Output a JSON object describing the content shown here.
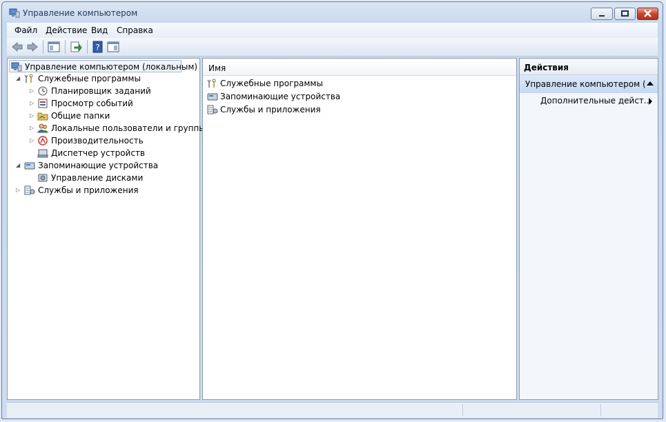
{
  "window": {
    "title": "Управление компьютером"
  },
  "menu": [
    "Файл",
    "Действие",
    "Вид",
    "Справка"
  ],
  "tree": {
    "root": "Управление компьютером (локальным)",
    "items": [
      {
        "label": "Служебные программы",
        "level": 1,
        "expanded": true
      },
      {
        "label": "Планировщик заданий",
        "level": 2,
        "expander": true
      },
      {
        "label": "Просмотр событий",
        "level": 2,
        "expander": true
      },
      {
        "label": "Общие папки",
        "level": 2,
        "expander": true
      },
      {
        "label": "Локальные пользователи и группы",
        "level": 2,
        "expander": true
      },
      {
        "label": "Производительность",
        "level": 2,
        "expander": true
      },
      {
        "label": "Диспетчер устройств",
        "level": 2,
        "expander": false
      },
      {
        "label": "Запоминающие устройства",
        "level": 1,
        "expanded": true
      },
      {
        "label": "Управление дисками",
        "level": 2,
        "expander": false
      },
      {
        "label": "Службы и приложения",
        "level": 1,
        "expanded": false
      }
    ]
  },
  "list": {
    "column": "Имя",
    "items": [
      "Служебные программы",
      "Запоминающие устройства",
      "Службы и приложения"
    ]
  },
  "actions": {
    "header": "Действия",
    "selected": "Управление компьютером (ло...",
    "more": "Дополнительные дейст..."
  },
  "icons": {
    "title": "computer-management-icon",
    "back": "back-arrow-icon",
    "forward": "forward-arrow-icon"
  }
}
